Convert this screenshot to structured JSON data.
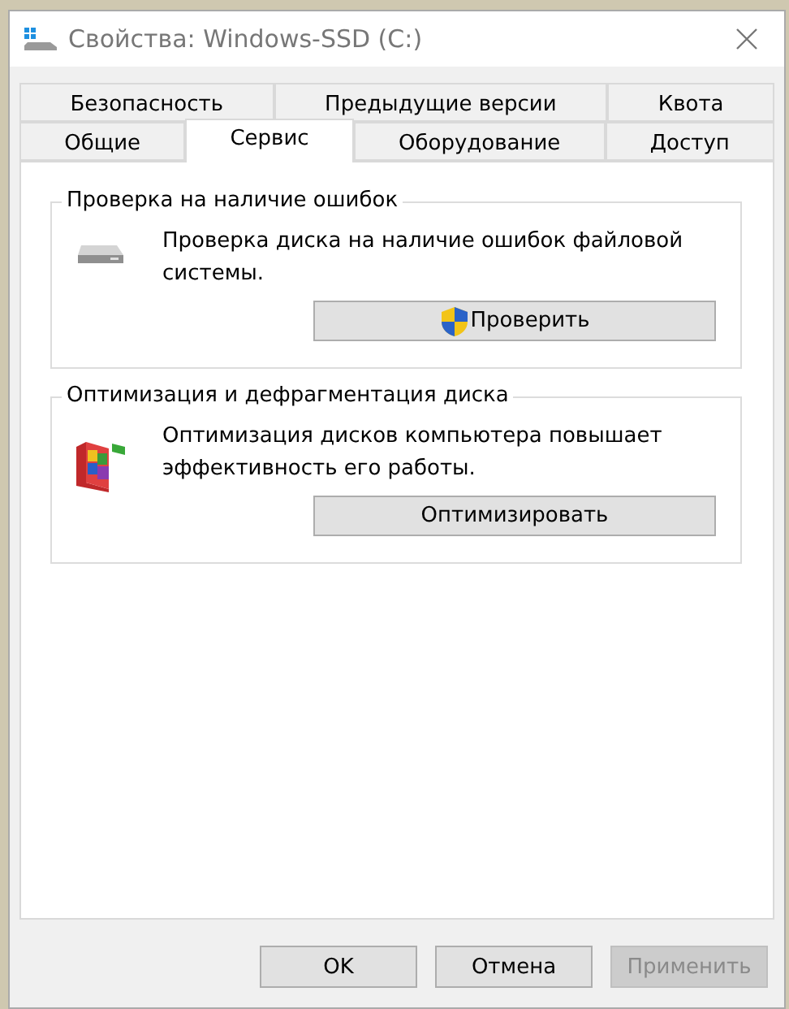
{
  "window": {
    "title": "Свойства: Windows-SSD (C:)"
  },
  "tab_rows": [
    [
      {
        "label": "Безопасность",
        "selected": false
      },
      {
        "label": "Предыдущие версии",
        "selected": false
      },
      {
        "label": "Квота",
        "selected": false
      }
    ],
    [
      {
        "label": "Общие",
        "selected": false
      },
      {
        "label": "Сервис",
        "selected": true
      },
      {
        "label": "Оборудование",
        "selected": false
      },
      {
        "label": "Доступ",
        "selected": false
      }
    ]
  ],
  "groups": [
    {
      "kind": "check",
      "title": "Проверка на наличие ошибок",
      "description": "Проверка диска на наличие ошибок файловой системы.",
      "button": {
        "label": "Проверить",
        "shield": true
      }
    },
    {
      "kind": "optimize",
      "title": "Оптимизация и дефрагментация диска",
      "description": "Оптимизация дисков компьютера повышает эффективность его работы.",
      "button": {
        "label": "Оптимизировать",
        "shield": false
      }
    }
  ],
  "buttons": [
    {
      "label": "OK",
      "disabled": false
    },
    {
      "label": "Отмена",
      "disabled": false
    },
    {
      "label": "Применить",
      "disabled": true
    }
  ]
}
